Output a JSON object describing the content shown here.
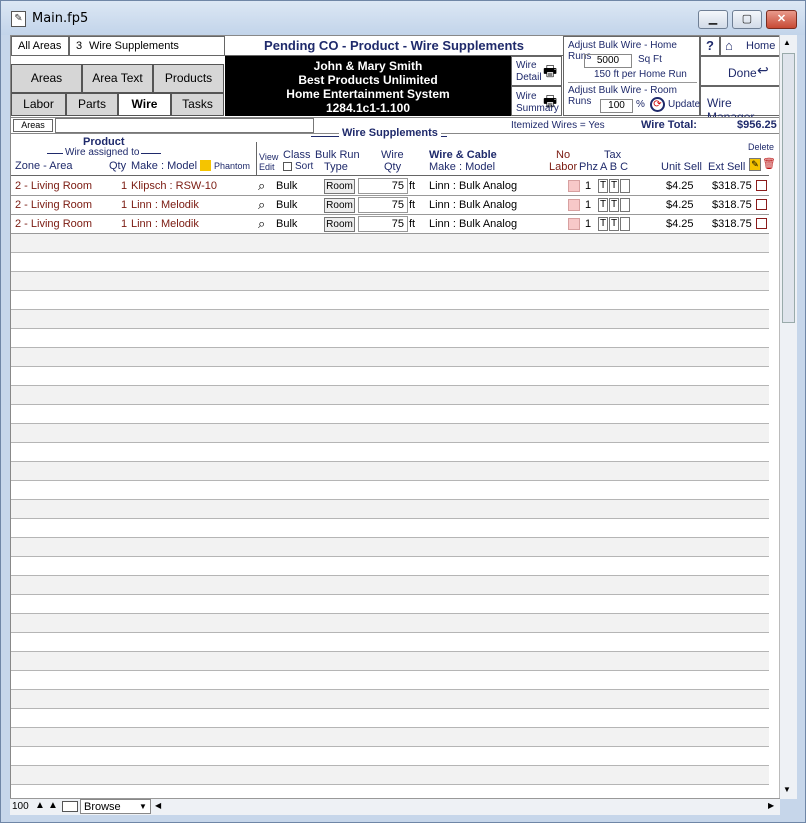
{
  "window": {
    "title": "Main.fp5",
    "min_icon": "minimize-icon",
    "max_icon": "maximize-icon",
    "close_icon": "close-icon"
  },
  "header": {
    "all_areas": "All Areas",
    "count": "3",
    "section_label": "Wire Supplements",
    "page_title": "Pending CO - Product - Wire Supplements"
  },
  "nav": {
    "areas": "Areas",
    "area_text": "Area Text",
    "products": "Products",
    "labor": "Labor",
    "parts": "Parts",
    "wire": "Wire",
    "tasks": "Tasks"
  },
  "client": {
    "name": "John & Mary Smith",
    "company": "Best Products Unlimited",
    "system": "Home Entertainment System",
    "job": "1284.1c1-1.100"
  },
  "print_buttons": {
    "detail_1": "Wire",
    "detail_2": "Detail",
    "summary_1": "Wire",
    "summary_2": "Summary"
  },
  "adjust": {
    "home_runs_label": "Adjust Bulk Wire - Home Runs",
    "sqft_value": "5000",
    "sqft_unit": "Sq Ft",
    "per_home_run": "150  ft per Home Run",
    "room_runs_label": "Adjust Bulk Wire - Room Runs",
    "percent_value": "100",
    "percent_unit": "%",
    "update": "Update"
  },
  "right_buttons": {
    "help": "?",
    "home": "Home",
    "done": "Done",
    "wire_manager": "Wire Manager"
  },
  "filter": {
    "areas_label": "Areas",
    "areas_value": ""
  },
  "supplements": {
    "section_title": "Wire Supplements",
    "itemized": "Itemized Wires = Yes",
    "total_label": "Wire Total:",
    "total_value": "$956.25"
  },
  "columns": {
    "product": "Product",
    "wire_assigned": "Wire assigned to",
    "zone_area": "Zone - Area",
    "qty": "Qty",
    "make_model": "Make : Model",
    "phantom": "Phantom",
    "view": "View",
    "edit": "Edit",
    "class": "Class",
    "sort": "Sort",
    "bulk_run": "Bulk Run",
    "type": "Type",
    "wire": "Wire",
    "wire_qty": "Qty",
    "wire_cable": "Wire & Cable",
    "wc_make_model": "Make : Model",
    "no": "No",
    "labor": "Labor",
    "phz": "Phz",
    "tax": "Tax",
    "tax_abc": "A B C",
    "unit_sell": "Unit Sell",
    "ext_sell": "Ext Sell",
    "delete": "Delete"
  },
  "rows": [
    {
      "zone": "2 - Living Room",
      "qty": "1",
      "model": "Klipsch : RSW-10",
      "class": "Bulk",
      "run_type": "Room",
      "wire_qty": "75",
      "unit": "ft",
      "wire_model": "Linn : Bulk Analog",
      "phz": "1",
      "tax_a": "T",
      "tax_b": "T",
      "unit_sell": "$4.25",
      "ext_sell": "$318.75"
    },
    {
      "zone": "2 - Living Room",
      "qty": "1",
      "model": "Linn : Melodik",
      "class": "Bulk",
      "run_type": "Room",
      "wire_qty": "75",
      "unit": "ft",
      "wire_model": "Linn : Bulk Analog",
      "phz": "1",
      "tax_a": "T",
      "tax_b": "T",
      "unit_sell": "$4.25",
      "ext_sell": "$318.75"
    },
    {
      "zone": "2 - Living Room",
      "qty": "1",
      "model": "Linn : Melodik",
      "class": "Bulk",
      "run_type": "Room",
      "wire_qty": "75",
      "unit": "ft",
      "wire_model": "Linn : Bulk Analog",
      "phz": "1",
      "tax_a": "T",
      "tax_b": "T",
      "unit_sell": "$4.25",
      "ext_sell": "$318.75"
    }
  ],
  "statusbar": {
    "zoom": "100",
    "mode": "Browse"
  },
  "colors": {
    "accent": "#1f2a6b",
    "maroon": "#7a1a10",
    "phantom": "#f5c400"
  }
}
